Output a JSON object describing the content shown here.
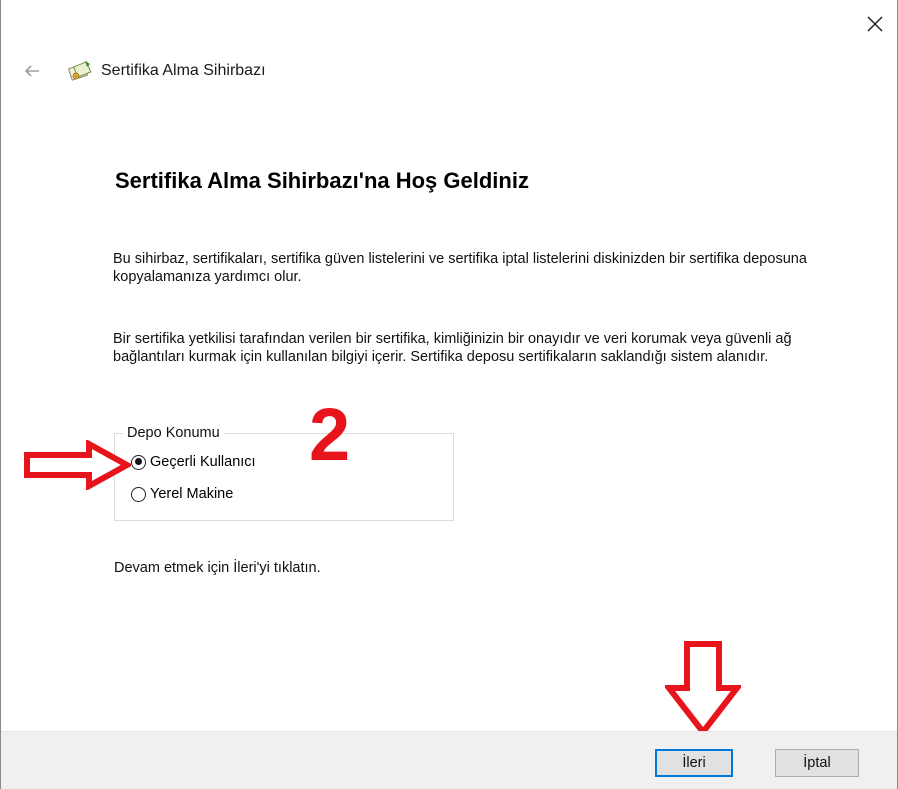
{
  "window": {
    "title": "Sertifika Alma Sihirbazı"
  },
  "icons": {
    "close": "close-icon",
    "back": "back-arrow-icon",
    "app": "certificate-icon"
  },
  "main": {
    "heading": "Sertifika Alma Sihirbazı'na Hoş Geldiniz",
    "paragraph1": "Bu sihirbaz, sertifikaları, sertifika güven listelerini ve sertifika iptal listelerini diskinizden bir sertifika deposuna kopyalamanıza yardımcı olur.",
    "paragraph2": "Bir sertifika yetkilisi tarafından verilen bir sertifika, kimliğinizin bir onayıdır ve veri korumak veya güvenli ağ bağlantıları kurmak için kullanılan bilgiyi içerir. Sertifika deposu sertifikaların saklandığı sistem alanıdır.",
    "store_location": {
      "legend": "Depo Konumu",
      "options": [
        {
          "label": "Geçerli Kullanıcı",
          "selected": true
        },
        {
          "label": "Yerel Makine",
          "selected": false
        }
      ]
    },
    "continue_text": "Devam etmek için İleri'yi tıklatın."
  },
  "annotations": {
    "step_number": "2",
    "color": "#e8141b"
  },
  "footer": {
    "next_label": "İleri",
    "cancel_label": "İptal"
  },
  "colors": {
    "accent": "#0078d7",
    "annotation": "#e8141b",
    "footer_bg": "#f0f0f0"
  }
}
